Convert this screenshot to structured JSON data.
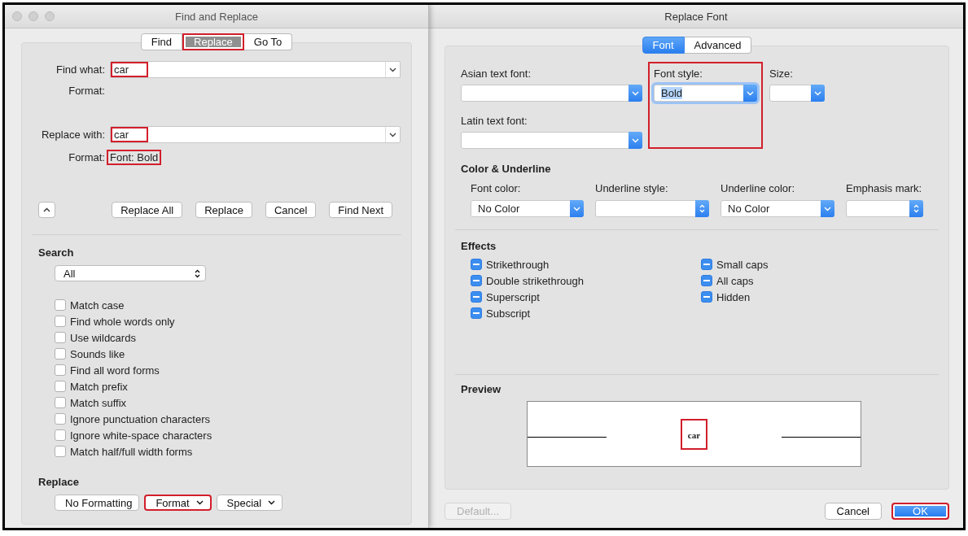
{
  "find_replace": {
    "title": "Find and Replace",
    "tabs": [
      {
        "label": "Find",
        "selected": false,
        "highlighted": false
      },
      {
        "label": "Replace",
        "selected": true,
        "highlighted": true
      },
      {
        "label": "Go To",
        "selected": false,
        "highlighted": false
      }
    ],
    "find_what": {
      "label": "Find what:",
      "value": "car",
      "highlighted": true
    },
    "find_format": {
      "label": "Format:"
    },
    "replace_with": {
      "label": "Replace with:",
      "value": "car",
      "highlighted": true
    },
    "replace_format": {
      "label": "Format:",
      "value": "Font: Bold",
      "highlighted": true
    },
    "buttons": [
      {
        "label": "Replace All"
      },
      {
        "label": "Replace"
      },
      {
        "label": "Cancel"
      },
      {
        "label": "Find Next"
      }
    ],
    "search": {
      "heading": "Search",
      "scope": "All",
      "options": [
        {
          "label": "Match case",
          "checked": false
        },
        {
          "label": "Find whole words only",
          "checked": false
        },
        {
          "label": "Use wildcards",
          "checked": false
        },
        {
          "label": "Sounds like",
          "checked": false
        },
        {
          "label": "Find all word forms",
          "checked": false
        },
        {
          "label": "Match prefix",
          "checked": false
        },
        {
          "label": "Match suffix",
          "checked": false
        },
        {
          "label": "Ignore punctuation characters",
          "checked": false
        },
        {
          "label": "Ignore white-space characters",
          "checked": false
        },
        {
          "label": "Match half/full width forms",
          "checked": false
        }
      ]
    },
    "replace": {
      "heading": "Replace",
      "buttons": [
        {
          "label": "No Formatting",
          "kind": "button",
          "highlighted": false
        },
        {
          "label": "Format",
          "kind": "menu",
          "highlighted": true
        },
        {
          "label": "Special",
          "kind": "menu",
          "highlighted": false
        }
      ]
    }
  },
  "replace_font": {
    "title": "Replace Font",
    "tabs": [
      {
        "label": "Font",
        "selected": true
      },
      {
        "label": "Advanced",
        "selected": false
      }
    ],
    "asian_font": {
      "label": "Asian text font:"
    },
    "font_style": {
      "label": "Font style:",
      "value": "Bold",
      "highlighted": true
    },
    "size": {
      "label": "Size:"
    },
    "latin_font": {
      "label": "Latin text font:"
    },
    "color_underline": {
      "heading": "Color & Underline",
      "fields": [
        {
          "label": "Font color:",
          "value": "No Color",
          "kind": "popup"
        },
        {
          "label": "Underline style:",
          "kind": "stepper"
        },
        {
          "label": "Underline color:",
          "value": "No Color",
          "kind": "popup"
        },
        {
          "label": "Emphasis mark:",
          "kind": "stepper"
        }
      ]
    },
    "effects": {
      "heading": "Effects",
      "columns": [
        [
          {
            "label": "Strikethrough",
            "mixed": true
          },
          {
            "label": "Double strikethrough",
            "mixed": true
          },
          {
            "label": "Superscript",
            "mixed": true
          },
          {
            "label": "Subscript",
            "mixed": true
          }
        ],
        [
          {
            "label": "Small caps",
            "mixed": true
          },
          {
            "label": "All caps",
            "mixed": true
          },
          {
            "label": "Hidden",
            "mixed": true
          }
        ]
      ]
    },
    "preview": {
      "heading": "Preview",
      "sample": "car",
      "highlighted": true
    },
    "buttons": [
      {
        "label": "Default...",
        "kind": "plain",
        "disabled": true,
        "highlighted": false
      },
      {
        "label": "Cancel",
        "kind": "plain",
        "disabled": false,
        "highlighted": false
      },
      {
        "label": "OK",
        "kind": "default",
        "disabled": false,
        "highlighted": true
      }
    ]
  }
}
